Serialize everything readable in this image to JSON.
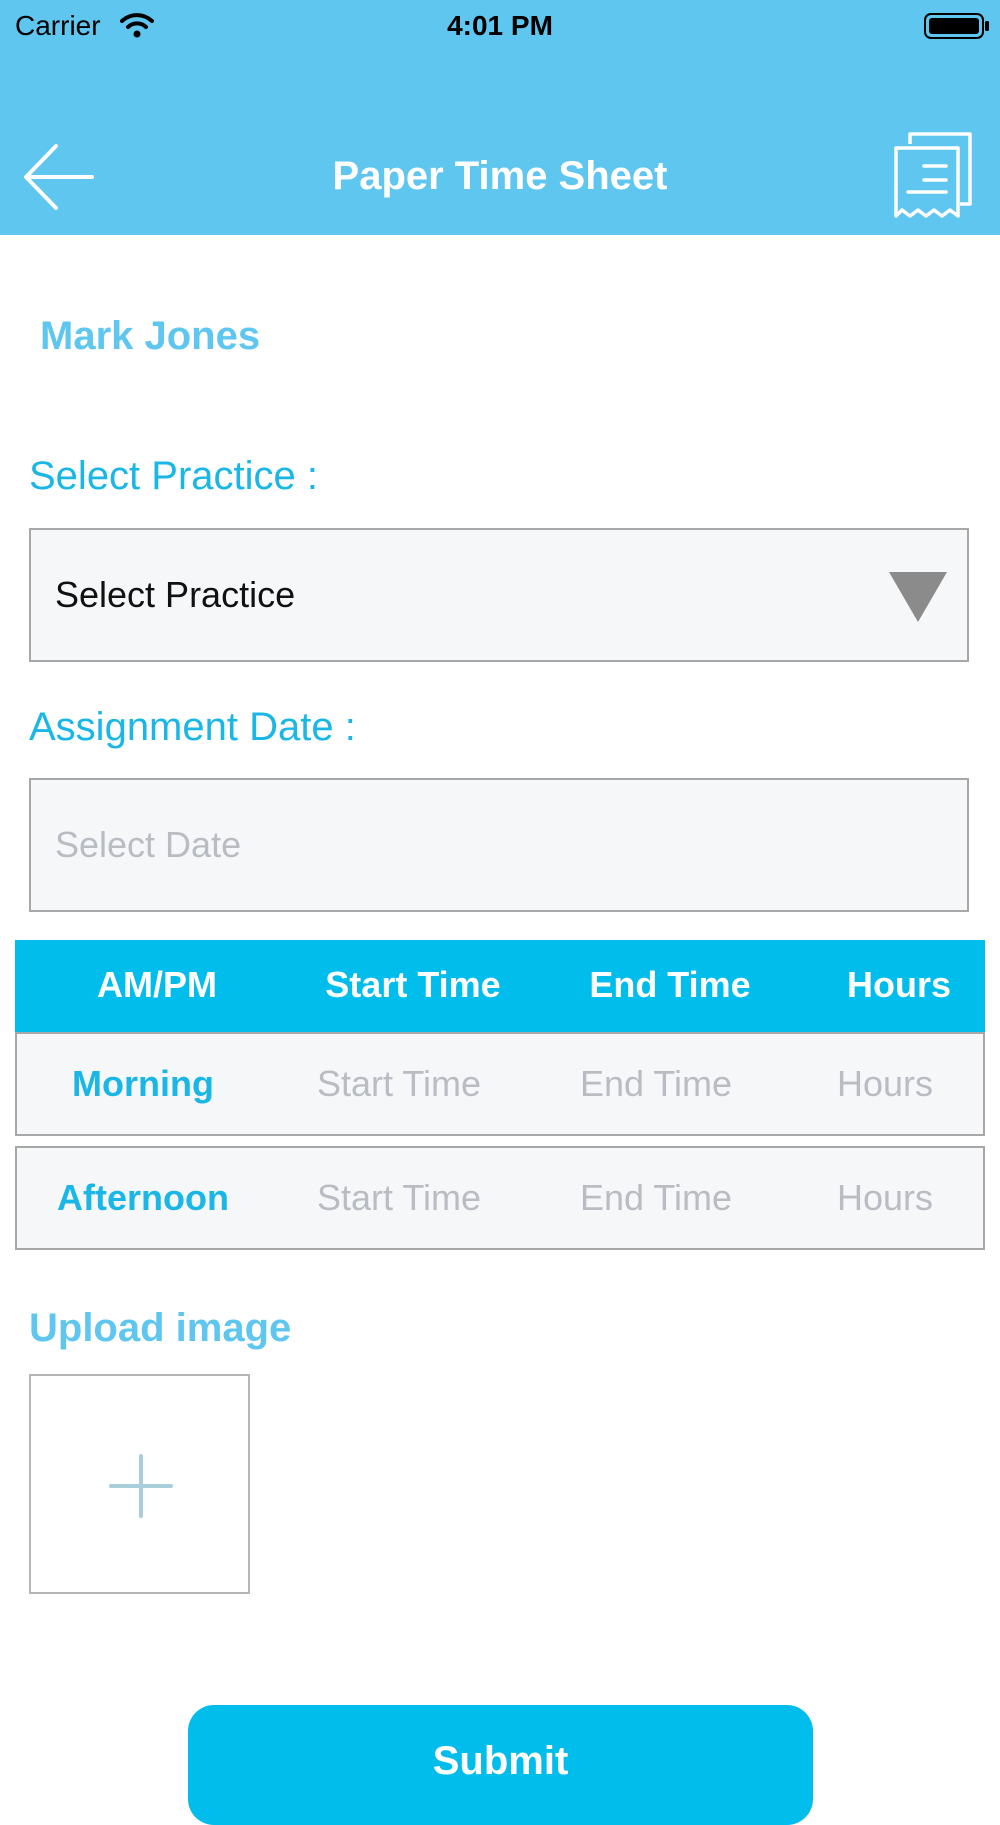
{
  "status_bar": {
    "carrier": "Carrier",
    "time": "4:01 PM"
  },
  "header": {
    "title": "Paper Time Sheet"
  },
  "user": {
    "name": "Mark Jones"
  },
  "practice": {
    "label": "Select Practice :",
    "selected": "Select Practice"
  },
  "assignment_date": {
    "label": "Assignment Date :",
    "placeholder": "Select Date"
  },
  "time_table": {
    "headers": [
      "AM/PM",
      "Start Time",
      "End Time",
      "Hours"
    ],
    "rows": [
      {
        "period": "Morning",
        "start": "Start Time",
        "end": "End Time",
        "hours": "Hours"
      },
      {
        "period": "Afternoon",
        "start": "Start Time",
        "end": "End Time",
        "hours": "Hours"
      }
    ]
  },
  "upload": {
    "label": "Upload image"
  },
  "submit_label": "Submit",
  "colors": {
    "header_bg": "#5ec6ef",
    "accent": "#00bdec",
    "label": "#1ab7e6"
  }
}
